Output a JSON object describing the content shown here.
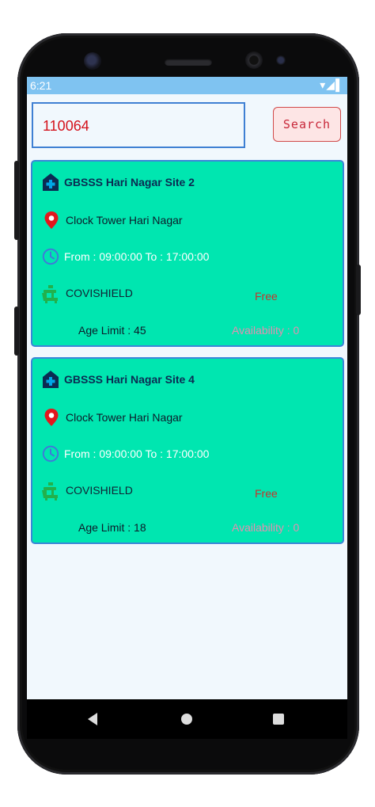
{
  "status_bar": {
    "time": "6:21",
    "icons": "▾◢▌"
  },
  "search": {
    "value": "110064",
    "button_label": "Search"
  },
  "centers": [
    {
      "name": "GBSSS Hari Nagar Site 2",
      "address": "Clock Tower Hari Nagar",
      "timing": "From : 09:00:00 To : 17:00:00",
      "vaccine": "COVISHIELD",
      "fee_type": "Free",
      "age_limit": "Age Limit : 45",
      "availability": "Availability : 0"
    },
    {
      "name": "GBSSS Hari Nagar Site 4",
      "address": "Clock Tower Hari Nagar",
      "timing": "From : 09:00:00 To : 17:00:00",
      "vaccine": "COVISHIELD",
      "fee_type": "Free",
      "age_limit": "Age Limit : 18",
      "availability": "Availability : 0"
    }
  ],
  "colors": {
    "card_bg": "#00e6b0",
    "card_border": "#3b86d8",
    "status_bar": "#7fc3f1",
    "search_text": "#d4121b",
    "fee_text": "#c3352c",
    "availability_text": "#e48fb0"
  },
  "icons": {
    "hospital": "hospital-icon",
    "location": "location-pin-icon",
    "clock": "clock-icon",
    "vaccine": "vaccine-chair-icon"
  }
}
